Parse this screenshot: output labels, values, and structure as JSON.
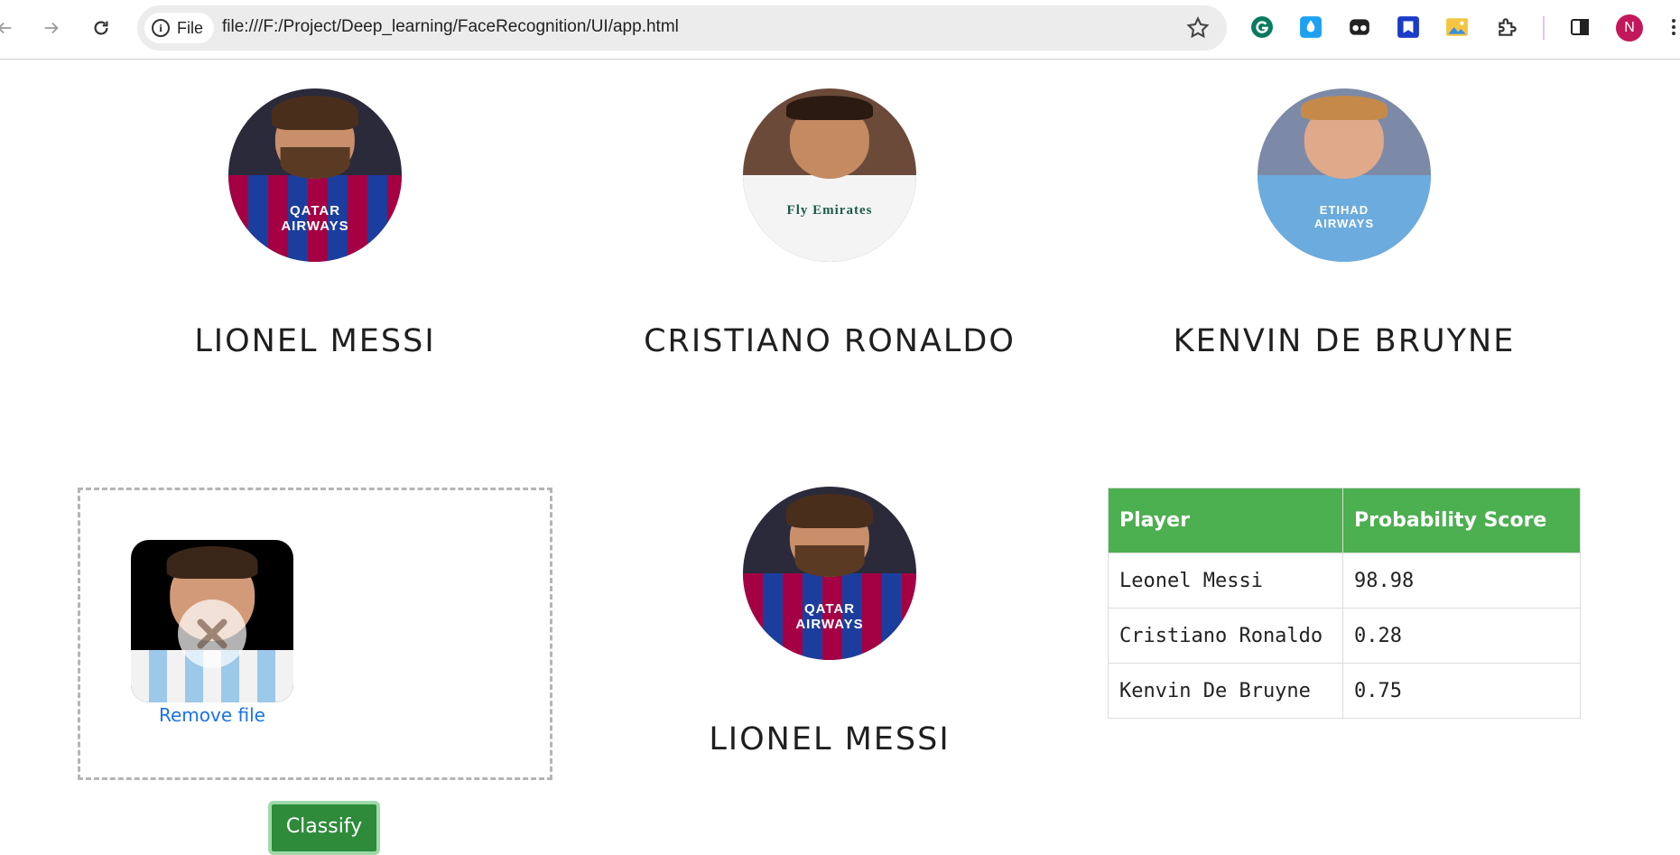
{
  "browser": {
    "site_chip": "File",
    "url": "file:///F:/Project/Deep_learning/FaceRecognition/UI/app.html",
    "profile_initial": "N"
  },
  "players": [
    {
      "name": "LIONEL MESSI",
      "sponsor": "QATAR AIRWAYS"
    },
    {
      "name": "CRISTIANO RONALDO",
      "sponsor": "Fly Emirates"
    },
    {
      "name": "KENVIN DE BRUYNE",
      "sponsor": "ETIHAD AIRWAYS"
    }
  ],
  "upload": {
    "remove_label": "Remove file",
    "classify_label": "Classify"
  },
  "result": {
    "name": "LIONEL MESSI",
    "sponsor": "QATAR AIRWAYS"
  },
  "table": {
    "headers": [
      "Player",
      "Probability Score"
    ],
    "rows": [
      [
        "Leonel Messi",
        "98.98"
      ],
      [
        "Cristiano Ronaldo",
        "0.28"
      ],
      [
        "Kenvin De Bruyne",
        "0.75"
      ]
    ]
  },
  "colors": {
    "table_header": "#4caf50",
    "classify_button": "#2e8b3a",
    "link": "#1a73e8",
    "avatar": "#c2185b"
  }
}
